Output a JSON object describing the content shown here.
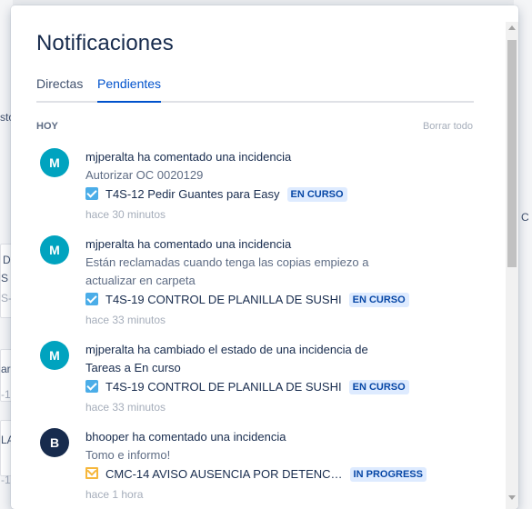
{
  "background": {
    "fragments": [
      "sto",
      "D",
      "S D",
      "S-",
      "ar",
      "-1",
      "LA",
      "-1",
      "C"
    ]
  },
  "panel": {
    "title": "Notificaciones",
    "tabs": [
      "Directas",
      "Pendientes"
    ],
    "active_tab": "Pendientes",
    "section_label": "HOY",
    "clear_all": "Borrar todo"
  },
  "notifications": [
    {
      "avatar": "M",
      "headline": "mjperalta ha comentado una incidencia",
      "comment": "Autorizar OC 0020129",
      "issue_type_icon": "checkbox-icon",
      "issue": "T4S-12 Pedir Guantes para Easy",
      "status": "EN CURSO",
      "time": "hace 30 minutos"
    },
    {
      "avatar": "M",
      "headline": "mjperalta ha comentado una incidencia",
      "comment": "Están reclamadas cuando tenga las copias empiezo a actualizar en carpeta",
      "issue_type_icon": "checkbox-icon",
      "issue": "T4S-19 CONTROL DE PLANILLA DE SUSHI",
      "status": "EN CURSO",
      "time": "hace 33 minutos"
    },
    {
      "avatar": "M",
      "headline": "mjperalta ha cambiado el estado de una incidencia de Tareas a En curso",
      "comment": "",
      "issue_type_icon": "checkbox-icon",
      "issue": "T4S-19 CONTROL DE PLANILLA DE SUSHI",
      "status": "EN CURSO",
      "time": "hace 33 minutos"
    },
    {
      "avatar": "B",
      "headline": "bhooper ha comentado una incidencia",
      "comment": "Tomo e informo!",
      "issue_type_icon": "mail-icon",
      "issue": "CMC-14 AVISO AUSENCIA POR DETENC…",
      "status": "IN PROGRESS",
      "time": "hace 1 hora"
    }
  ],
  "colors": {
    "accent": "#0052cc",
    "avatar_teal": "#00a3bf",
    "avatar_dark": "#172b4d",
    "lozenge_bg": "#deebff",
    "lozenge_text": "#0747a6"
  }
}
